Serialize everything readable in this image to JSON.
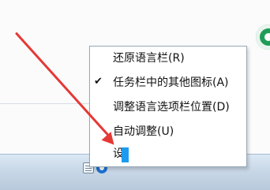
{
  "menu": {
    "items": [
      {
        "label": "还原语言栏(R)",
        "checked": false
      },
      {
        "label": "任务栏中的其他图标(A)",
        "checked": true
      },
      {
        "label": "调整语言选项栏位置(D)",
        "checked": false
      },
      {
        "label": "自动调整(U)",
        "checked": false
      },
      {
        "label": "设",
        "checked": false
      }
    ]
  },
  "icons": {
    "check": "✔",
    "tray_left": "document-icon",
    "tray_right": "language-indicator-icon"
  },
  "colors": {
    "arrow": "#e53935",
    "selection_block": "#1d9bf0",
    "taskbar": "#c9d8e7"
  }
}
